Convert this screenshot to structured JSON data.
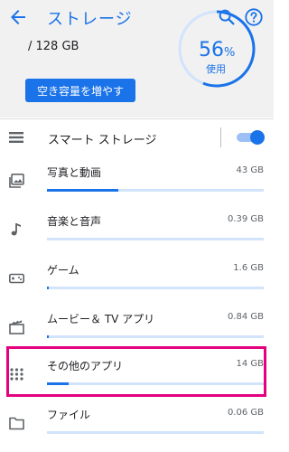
{
  "header": {
    "title": "ストレージ",
    "back_icon": "arrow-back-icon",
    "search_icon": "search-icon",
    "help_icon": "help-icon"
  },
  "summary": {
    "used_total": "/ 128 GB",
    "percent": "56",
    "percent_sign": "%",
    "percent_label": "使用",
    "percent_used": 56,
    "free_button": "空き容量を増やす"
  },
  "smart_storage": {
    "label": "スマート ストレージ",
    "enabled": true,
    "icon": "list-icon"
  },
  "categories": [
    {
      "label": "写真と動画",
      "size": "43 GB",
      "fill": 0.33,
      "icon": "photo-icon"
    },
    {
      "label": "音楽と音声",
      "size": "0.39 GB",
      "fill": 0.0,
      "icon": "music-note-icon"
    },
    {
      "label": "ゲーム",
      "size": "1.6 GB",
      "fill": 0.01,
      "icon": "gamepad-icon"
    },
    {
      "label": "ムービー＆ TV アプリ",
      "size": "0.84 GB",
      "fill": 0.01,
      "icon": "movie-icon"
    },
    {
      "label": "その他のアプリ",
      "size": "14 GB",
      "fill": 0.1,
      "icon": "apps-grid-icon"
    },
    {
      "label": "ファイル",
      "size": "0.06 GB",
      "fill": 0.0,
      "icon": "folder-icon"
    }
  ],
  "colors": {
    "accent": "#1a73e8",
    "track": "#d2e3fc",
    "highlight": "#e4007f"
  }
}
